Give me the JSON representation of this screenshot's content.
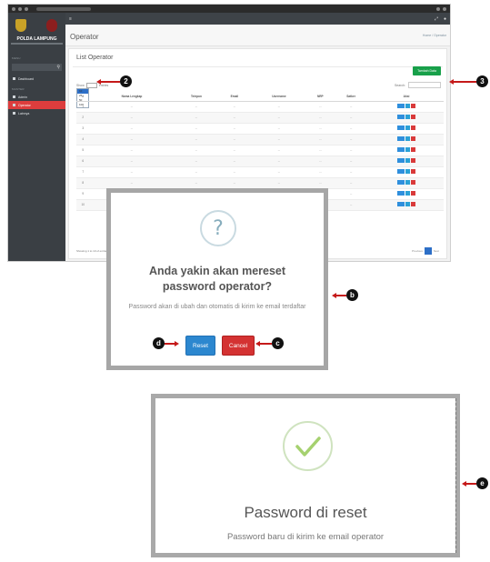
{
  "app": {
    "brand": "POLDA LAMPUNG",
    "menu_label": "MENU",
    "master_label": "MASTER",
    "page_title": "Operator",
    "breadcrumb": "Home / Operator"
  },
  "sidebar": {
    "items": [
      {
        "label": "Dashboard"
      },
      {
        "label": "Admin"
      },
      {
        "label": "Operator"
      },
      {
        "label": "Lainnya"
      }
    ]
  },
  "card": {
    "title": "List Operator",
    "add_button": "Tambah Data",
    "show_label": "Show",
    "entries_label": "entries",
    "search_label": "Search:",
    "page_size_options": [
      "10",
      "25",
      "50",
      "100"
    ]
  },
  "table": {
    "headers": [
      "#",
      "Nama Lengkap",
      "Telepon",
      "Email",
      "Username",
      "NRP",
      "Satker",
      "Aksi"
    ],
    "rows": [
      [
        "1",
        "...",
        "...",
        "...",
        "...",
        "...",
        "...",
        ""
      ],
      [
        "2",
        "...",
        "...",
        "...",
        "...",
        "...",
        "...",
        ""
      ],
      [
        "3",
        "...",
        "...",
        "...",
        "...",
        "...",
        "...",
        ""
      ],
      [
        "4",
        "...",
        "...",
        "...",
        "...",
        "...",
        "...",
        ""
      ],
      [
        "5",
        "...",
        "...",
        "...",
        "...",
        "...",
        "...",
        ""
      ],
      [
        "6",
        "...",
        "...",
        "...",
        "...",
        "...",
        "...",
        ""
      ],
      [
        "7",
        "...",
        "...",
        "...",
        "...",
        "...",
        "...",
        ""
      ],
      [
        "8",
        "...",
        "...",
        "...",
        "...",
        "...",
        "...",
        ""
      ],
      [
        "9",
        "...",
        "...",
        "...",
        "...",
        "...",
        "...",
        ""
      ],
      [
        "10",
        "...",
        "...",
        "...",
        "...",
        "...",
        "...",
        ""
      ]
    ],
    "footer": "Showing 1 to 10 of entries"
  },
  "pager": {
    "prev": "Previous",
    "current": "1",
    "next": "Next"
  },
  "modal_confirm": {
    "icon": "?",
    "title": "Anda yakin akan mereset password operator?",
    "text": "Password akan di ubah dan otomatis di kirim ke email terdaftar",
    "reset_label": "Reset",
    "cancel_label": "Cancel"
  },
  "modal_success": {
    "title": "Password di reset",
    "text": "Password baru di kirim ke email operator"
  },
  "callouts": {
    "c2": "2",
    "c3": "3",
    "b": "b",
    "c": "c",
    "d": "d",
    "e": "e"
  },
  "colors": {
    "accent_red": "#dd3d3d",
    "primary_blue": "#2c87cf",
    "success_green": "#18a04a",
    "callout_arrow": "#c51919"
  }
}
